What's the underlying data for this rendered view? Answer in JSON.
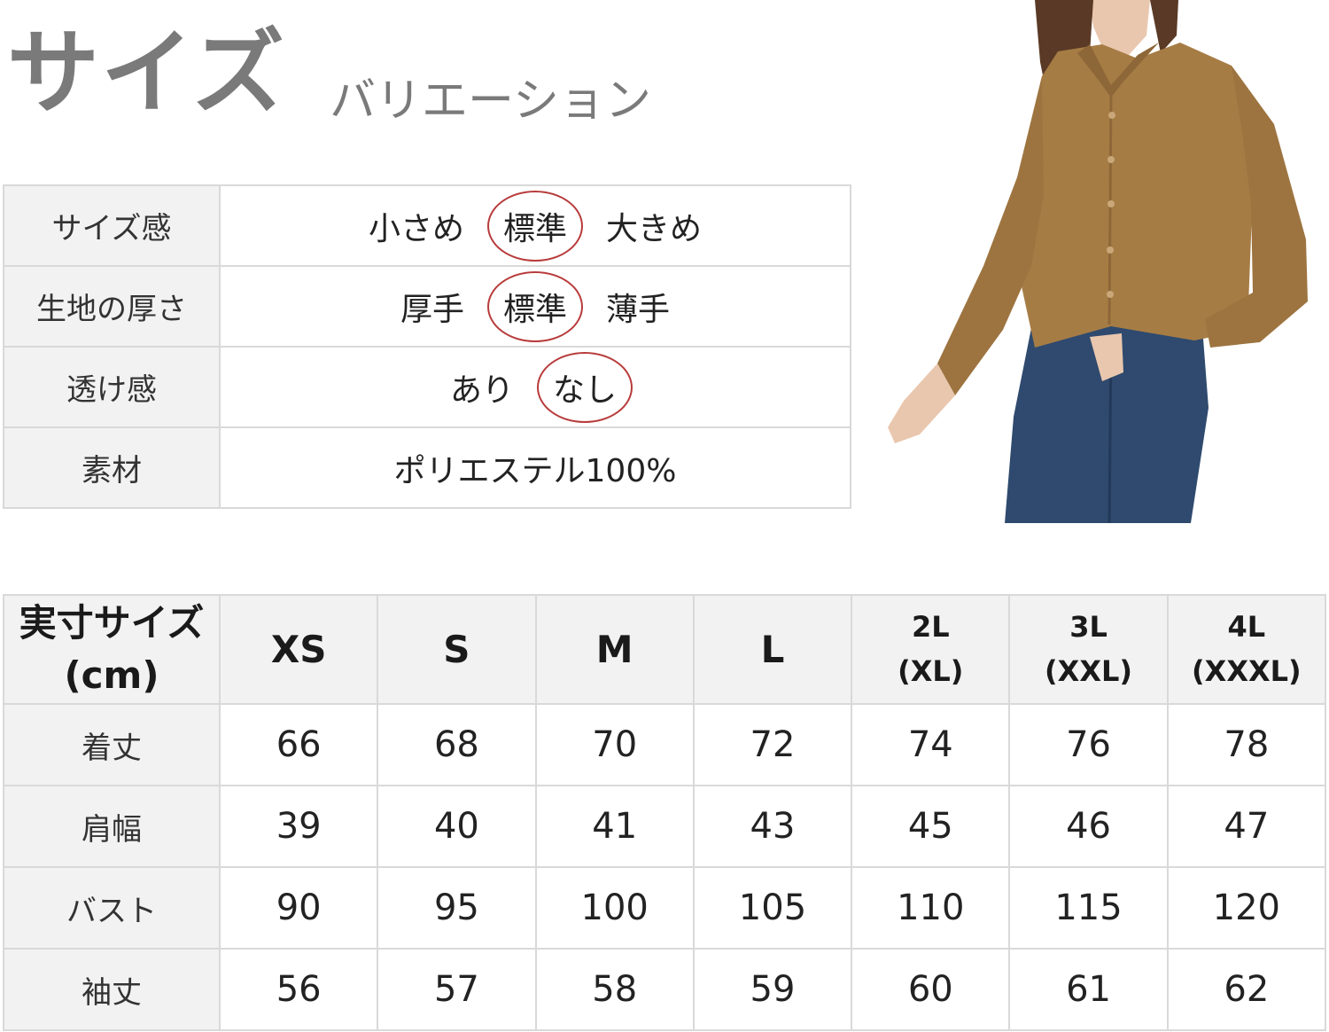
{
  "heading": {
    "main": "サイズ",
    "sub": "バリエーション"
  },
  "attributes": [
    {
      "label": "サイズ感",
      "options": [
        "小さめ",
        "標準",
        "大きめ"
      ],
      "selected": 1
    },
    {
      "label": "生地の厚さ",
      "options": [
        "厚手",
        "標準",
        "薄手"
      ],
      "selected": 1
    },
    {
      "label": "透け感",
      "options": [
        "あり",
        "なし"
      ],
      "selected": 1
    },
    {
      "label": "素材",
      "value": "ポリエステル100%"
    }
  ],
  "size_table": {
    "corner_line1": "実寸サイズ",
    "corner_line2": "(cm)",
    "sizes": [
      {
        "line1": "XS",
        "line2": ""
      },
      {
        "line1": "S",
        "line2": ""
      },
      {
        "line1": "M",
        "line2": ""
      },
      {
        "line1": "L",
        "line2": ""
      },
      {
        "line1": "2L",
        "line2": "(XL)"
      },
      {
        "line1": "3L",
        "line2": "(XXL)"
      },
      {
        "line1": "4L",
        "line2": "(XXXL)"
      }
    ],
    "rows": [
      {
        "label": "着丈",
        "values": [
          "66",
          "68",
          "70",
          "72",
          "74",
          "76",
          "78"
        ]
      },
      {
        "label": "肩幅",
        "values": [
          "39",
          "40",
          "41",
          "43",
          "45",
          "46",
          "47"
        ]
      },
      {
        "label": "バスト",
        "values": [
          "90",
          "95",
          "100",
          "105",
          "110",
          "115",
          "120"
        ]
      },
      {
        "label": "袖丈",
        "values": [
          "56",
          "57",
          "58",
          "59",
          "60",
          "61",
          "62"
        ]
      }
    ]
  },
  "colors": {
    "shirt": "#a67c45",
    "jeans": "#2f4a6e",
    "highlight_circle": "#b83b3b"
  }
}
